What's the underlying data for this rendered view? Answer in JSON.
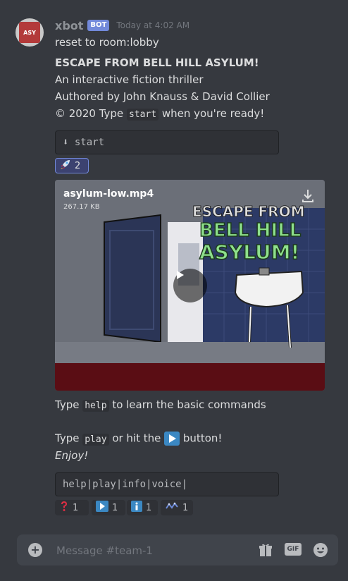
{
  "message": {
    "username": "xbot",
    "bot_tag": "BOT",
    "timestamp": "Today at 4:02 AM",
    "avatar_text": "ASY",
    "lines": {
      "reset": "reset to room:lobby",
      "title": "ESCAPE FROM BELL HILL ASYLUM!",
      "subtitle": " An interactive fiction thriller",
      "authors": " Authored by John Knauss & David Collier",
      "copyright_prefix": " © 2020 Type ",
      "copyright_code": "start",
      "copyright_suffix": " when you're ready!"
    },
    "codeblock1": "⬇ start",
    "reaction1": {
      "icon": "rocket-icon",
      "count": "2"
    },
    "video": {
      "filename": "asylum-low.mp4",
      "size": "267.17 KB",
      "overlay_title_1": "ESCAPE FROM",
      "overlay_title_2": "BELL HILL",
      "overlay_title_3": "ASYLUM!"
    },
    "help_prefix": "Type ",
    "help_code": "help",
    "help_suffix": " to learn the basic commands",
    "play_prefix": "Type ",
    "play_code": "play",
    "play_middle": " or hit the ",
    "play_suffix": " button!",
    "enjoy": "Enjoy!",
    "codeblock2": "help|play|info|voice|",
    "reactions": [
      {
        "icon": "question-icon",
        "count": "1"
      },
      {
        "icon": "play-icon",
        "count": "1"
      },
      {
        "icon": "info-icon",
        "count": "1"
      },
      {
        "icon": "voice-icon",
        "count": "1"
      }
    ]
  },
  "composer": {
    "placeholder": "Message #team-1",
    "gif_label": "GIF"
  },
  "colors": {
    "background": "#36393f",
    "bot_tag": "#7289da",
    "composer": "#40444b"
  }
}
